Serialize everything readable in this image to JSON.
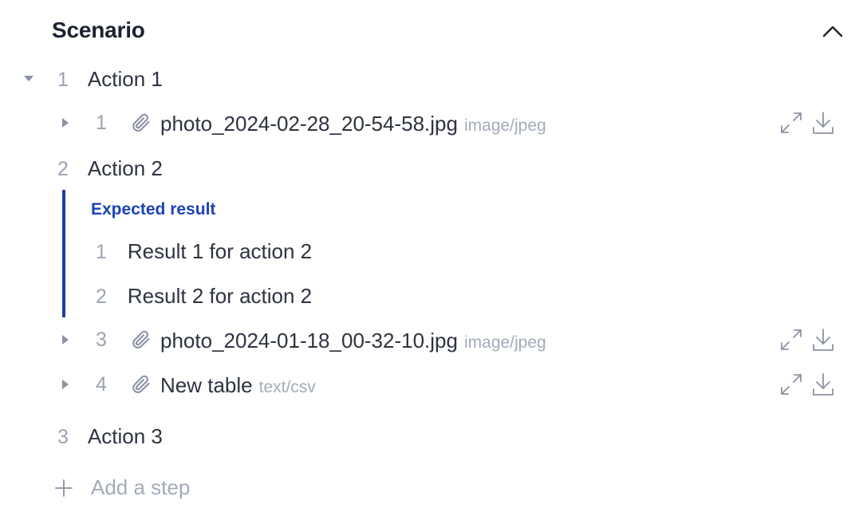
{
  "section": {
    "title": "Scenario"
  },
  "steps": [
    {
      "number": "1",
      "label": "Action 1"
    },
    {
      "number": "2",
      "label": "Action 2"
    },
    {
      "number": "3",
      "label": "Action 3"
    }
  ],
  "attachments": [
    {
      "number": "1",
      "name": "photo_2024-02-28_20-54-58.jpg",
      "type": "image/jpeg"
    },
    {
      "number": "3",
      "name": "photo_2024-01-18_00-32-10.jpg",
      "type": "image/jpeg"
    },
    {
      "number": "4",
      "name": "New table",
      "type": "text/csv"
    }
  ],
  "expected_result": {
    "heading": "Expected result",
    "items": [
      {
        "number": "1",
        "text": "Result 1 for action 2"
      },
      {
        "number": "2",
        "text": "Result 2 for action 2"
      }
    ]
  },
  "add_step": {
    "label": "Add a step"
  },
  "icons": {
    "collapse": "chevron-up-icon",
    "step_expanded": "triangle-down-icon",
    "attachment_collapsed": "triangle-right-icon",
    "attachment": "paperclip-icon",
    "expand": "expand-icon",
    "download": "download-icon",
    "add": "plus-icon"
  },
  "colors": {
    "accent": "#1d43b5",
    "text": "#2d3340",
    "muted": "#a3abba"
  }
}
